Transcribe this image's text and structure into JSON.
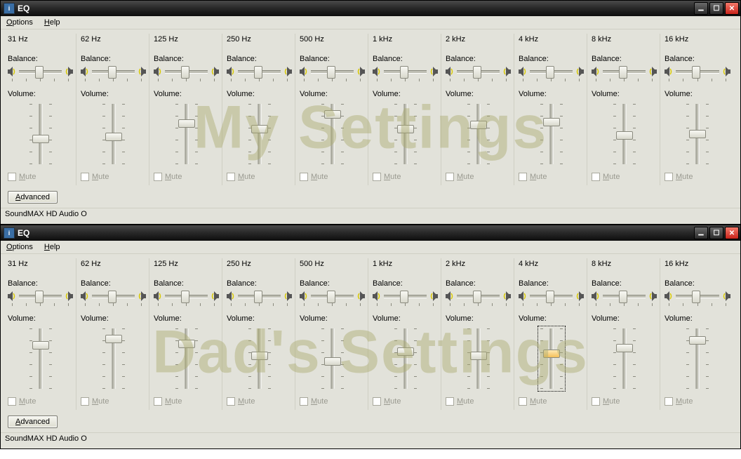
{
  "windows": [
    {
      "title": "EQ",
      "watermark": "My Settings",
      "menu": {
        "options": "Options",
        "help": "Help"
      },
      "status": "SoundMAX HD Audio O",
      "advanced_label": "Advanced",
      "balance_label": "Balance:",
      "volume_label": "Volume:",
      "mute_label": "Mute",
      "bands": [
        {
          "freq": "31 Hz",
          "balance": 50,
          "volume": 42,
          "mute": false
        },
        {
          "freq": "62 Hz",
          "balance": 50,
          "volume": 45,
          "mute": false
        },
        {
          "freq": "125 Hz",
          "balance": 50,
          "volume": 68,
          "mute": false
        },
        {
          "freq": "250 Hz",
          "balance": 50,
          "volume": 58,
          "mute": false
        },
        {
          "freq": "500 Hz",
          "balance": 50,
          "volume": 82,
          "mute": false
        },
        {
          "freq": "1 kHz",
          "balance": 50,
          "volume": 58,
          "mute": false
        },
        {
          "freq": "2 kHz",
          "balance": 50,
          "volume": 65,
          "mute": false
        },
        {
          "freq": "4 kHz",
          "balance": 50,
          "volume": 70,
          "mute": false
        },
        {
          "freq": "8 kHz",
          "balance": 50,
          "volume": 48,
          "mute": false
        },
        {
          "freq": "16 kHz",
          "balance": 50,
          "volume": 50,
          "mute": false
        }
      ]
    },
    {
      "title": "EQ",
      "watermark": "Dad's Settings",
      "menu": {
        "options": "Options",
        "help": "Help"
      },
      "status": "SoundMAX HD Audio O",
      "advanced_label": "Advanced",
      "balance_label": "Balance:",
      "volume_label": "Volume:",
      "mute_label": "Mute",
      "bands": [
        {
          "freq": "31 Hz",
          "balance": 50,
          "volume": 72,
          "mute": false
        },
        {
          "freq": "62 Hz",
          "balance": 50,
          "volume": 82,
          "mute": false
        },
        {
          "freq": "125 Hz",
          "balance": 50,
          "volume": 75,
          "mute": false
        },
        {
          "freq": "250 Hz",
          "balance": 50,
          "volume": 55,
          "mute": false
        },
        {
          "freq": "500 Hz",
          "balance": 50,
          "volume": 45,
          "mute": false
        },
        {
          "freq": "1 kHz",
          "balance": 50,
          "volume": 62,
          "mute": false
        },
        {
          "freq": "2 kHz",
          "balance": 50,
          "volume": 55,
          "mute": false
        },
        {
          "freq": "4 kHz",
          "balance": 50,
          "volume": 58,
          "mute": false,
          "focused": true,
          "highlight": true
        },
        {
          "freq": "8 kHz",
          "balance": 50,
          "volume": 68,
          "mute": false
        },
        {
          "freq": "16 kHz",
          "balance": 50,
          "volume": 80,
          "mute": false
        }
      ]
    }
  ]
}
